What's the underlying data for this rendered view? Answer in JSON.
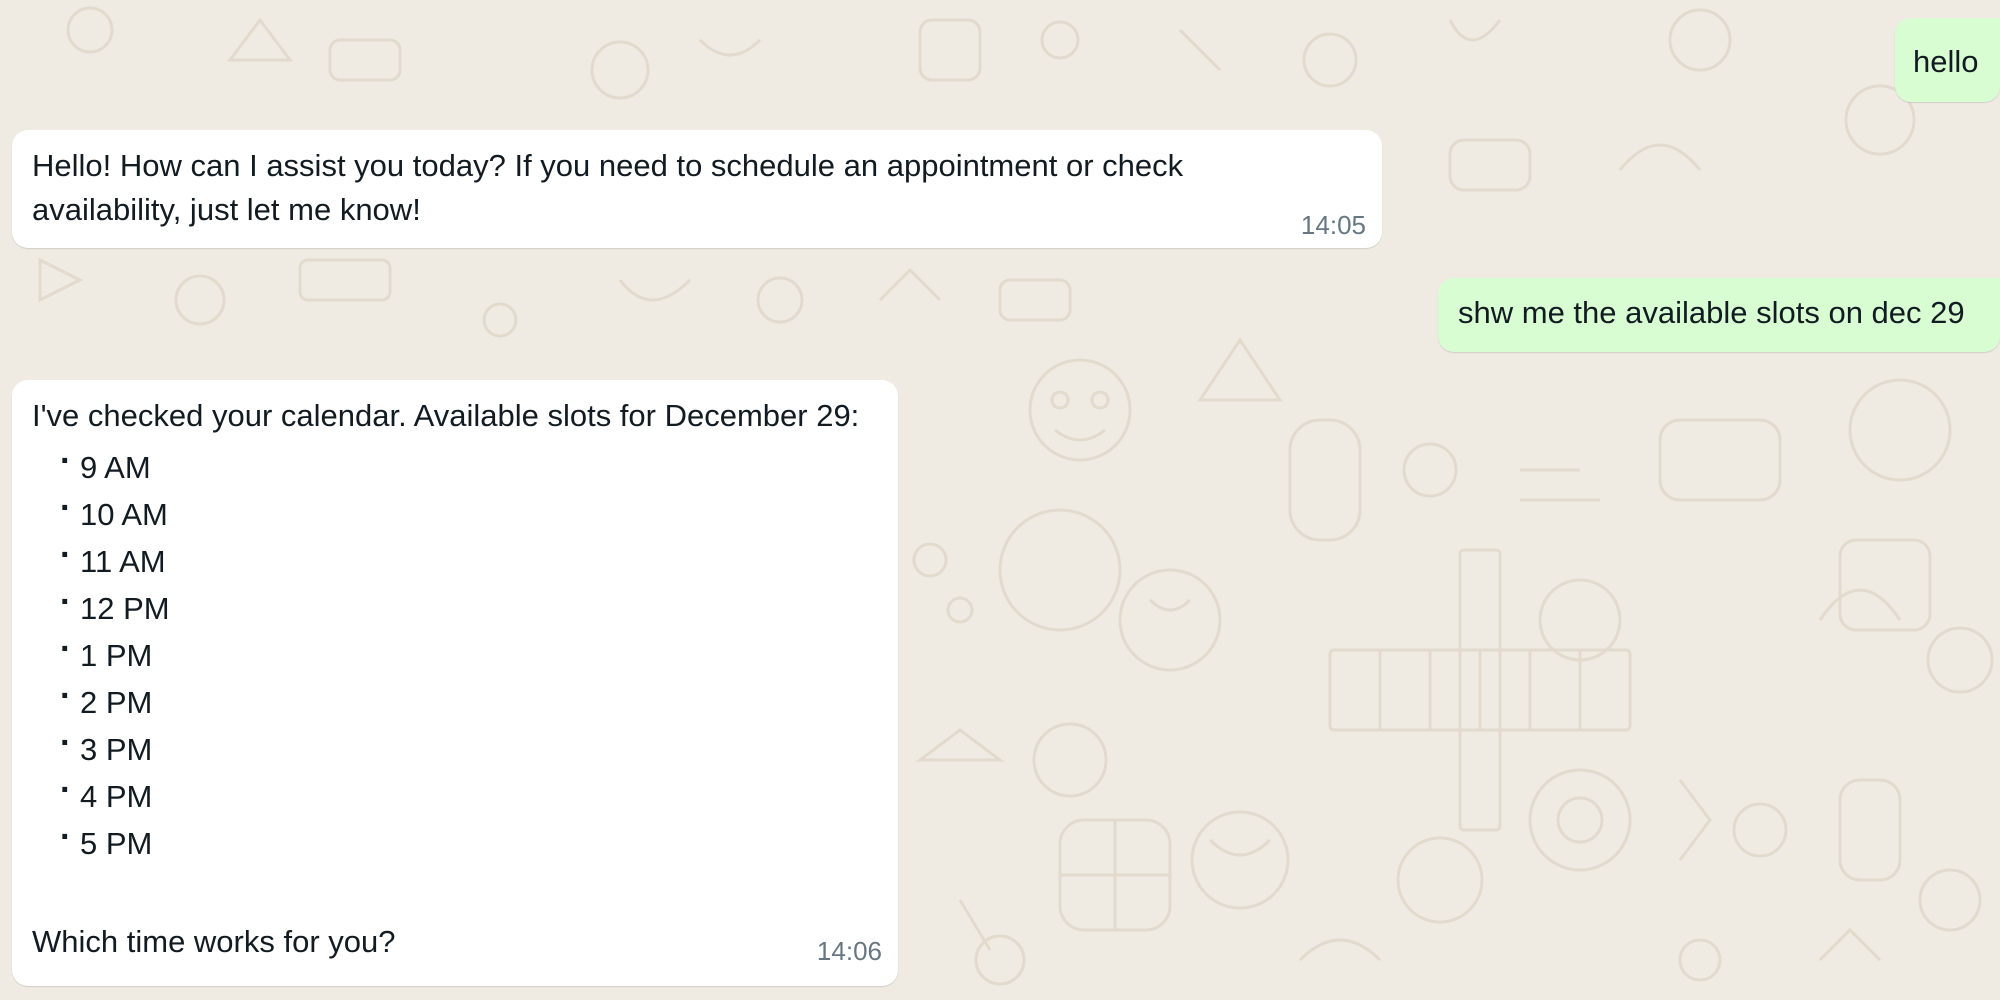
{
  "colors": {
    "background": "#efeae2",
    "outgoing_bubble": "#d9fdd3",
    "incoming_bubble": "#ffffff",
    "text": "#111b21",
    "timestamp": "#667781"
  },
  "messages": [
    {
      "direction": "outgoing",
      "text": "hello"
    },
    {
      "direction": "incoming",
      "text": "Hello! How can I assist you today? If you need to schedule an appointment or check availability, just let me know!",
      "time": "14:05"
    },
    {
      "direction": "outgoing",
      "text": "shw me the available slots on dec 29"
    },
    {
      "direction": "incoming",
      "intro": "I've checked your calendar. Available slots for December 29:",
      "slots": [
        "9 AM",
        "10 AM",
        "11 AM",
        "12 PM",
        "1 PM",
        "2 PM",
        "3 PM",
        "4 PM",
        "5 PM"
      ],
      "outro": "Which time works for you?",
      "time": "14:06"
    }
  ]
}
